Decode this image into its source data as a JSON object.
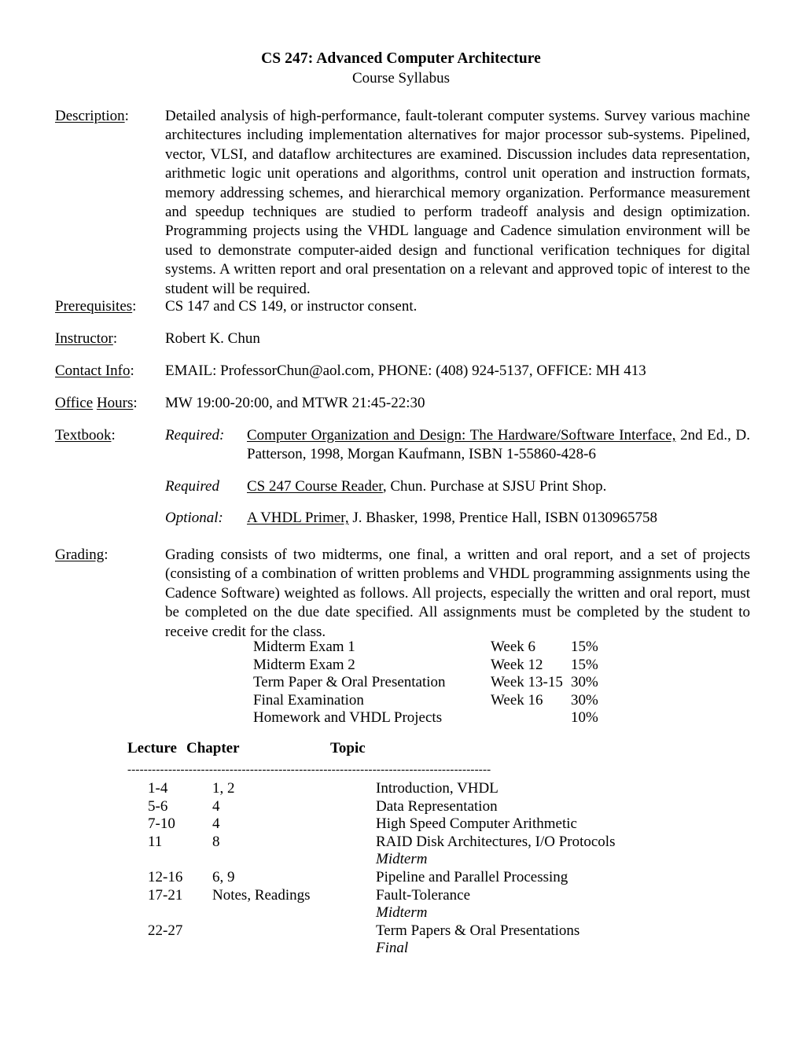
{
  "header": {
    "title": "CS 247:  Advanced Computer Architecture",
    "subtitle": "Course Syllabus"
  },
  "sections": {
    "description": {
      "label": "Description",
      "colon": ":",
      "text": "Detailed analysis of high-performance, fault-tolerant computer systems.  Survey various machine architectures including implementation alternatives for major processor sub-systems.  Pipelined, vector, VLSI, and dataflow architectures are examined.  Discussion includes data representation, arithmetic logic unit operations and algorithms, control unit operation and instruction formats, memory addressing schemes, and hierarchical memory organization.  Performance measurement and speedup techniques are studied to perform tradeoff analysis and design optimization.  Programming projects using the VHDL language and Cadence simulation environment will be used to demonstrate computer-aided design and functional verification techniques for digital systems.  A written report and oral presentation on a relevant and approved topic of interest to the student will be required."
    },
    "prerequisites": {
      "label": "Prerequisites",
      "colon": ":",
      "text": "CS 147 and CS 149, or instructor consent."
    },
    "instructor": {
      "label": "Instructor",
      "colon": ":",
      "text": "Robert K. Chun"
    },
    "contact_info": {
      "label": "Contact Info",
      "colon": ":",
      "text": "EMAIL:  ProfessorChun@aol.com,  PHONE:  (408) 924-5137,  OFFICE:  MH 413"
    },
    "office_hours": {
      "label_word1": "Office",
      "label_word2": "Hours",
      "colon": ":",
      "text": "MW 19:00-20:00, and MTWR  21:45-22:30"
    },
    "textbook": {
      "label": "Textbook",
      "colon": ":",
      "entries": [
        {
          "kind": "Required:",
          "title": "Computer Organization and Design: The Hardware/Software Interface,",
          "rest": " 2nd Ed., D. Patterson, 1998, Morgan Kaufmann, ISBN 1-55860-428-6"
        },
        {
          "kind": "Required",
          "title": "CS 247 Course Reader",
          "rest": ", Chun.  Purchase at SJSU Print Shop."
        },
        {
          "kind": "Optional:",
          "title": "A VHDL Primer,",
          "rest": " J. Bhasker, 1998, Prentice Hall, ISBN 0130965758"
        }
      ]
    },
    "grading": {
      "label": "Grading",
      "colon": ":",
      "text": "Grading consists of two midterms, one final, a written and oral report, and a set of projects (consisting of a combination of written problems and VHDL programming assignments using the Cadence Software) weighted as follows.  All projects, especially the written and oral report, must be completed on the due date specified.  All assignments must be completed by the student to receive credit for the class."
    }
  },
  "weights": {
    "rows": [
      {
        "item": "Midterm Exam 1",
        "when": "Week 6",
        "pct": "15%"
      },
      {
        "item": "Midterm Exam 2",
        "when": "Week 12",
        "pct": "15%"
      },
      {
        "item": "Term Paper & Oral Presentation",
        "when": "Week 13-15",
        "pct": "30%"
      },
      {
        "item": "Final Examination",
        "when": "Week 16",
        "pct": "30%"
      },
      {
        "item": "Homework and VHDL Projects",
        "when": "",
        "pct": "10%"
      }
    ]
  },
  "schedule": {
    "headers": {
      "lecture": "Lecture",
      "chapter": "Chapter",
      "topic": "Topic"
    },
    "rule": "-----------------------------------------------------------------------------------------",
    "rows": [
      {
        "lecture": "1-4",
        "chapter": "1, 2",
        "topic": "Introduction, VHDL",
        "italic": false
      },
      {
        "lecture": "5-6",
        "chapter": "4",
        "topic": "Data Representation",
        "italic": false
      },
      {
        "lecture": "7-10",
        "chapter": "4",
        "topic": "High Speed Computer Arithmetic",
        "italic": false
      },
      {
        "lecture": "11",
        "chapter": "8",
        "topic": "RAID Disk Architectures, I/O Protocols",
        "italic": false
      },
      {
        "lecture": "",
        "chapter": "",
        "topic": "Midterm",
        "italic": true
      },
      {
        "lecture": "12-16",
        "chapter": "6, 9",
        "topic": "Pipeline and Parallel Processing",
        "italic": false
      },
      {
        "lecture": "17-21",
        "chapter": "Notes, Readings",
        "topic": "Fault-Tolerance",
        "italic": false
      },
      {
        "lecture": "",
        "chapter": "",
        "topic": "Midterm",
        "italic": true
      },
      {
        "lecture": "22-27",
        "chapter": "",
        "topic": "Term Papers & Oral Presentations",
        "italic": false
      },
      {
        "lecture": "",
        "chapter": "",
        "topic": "Final",
        "italic": true
      }
    ]
  }
}
